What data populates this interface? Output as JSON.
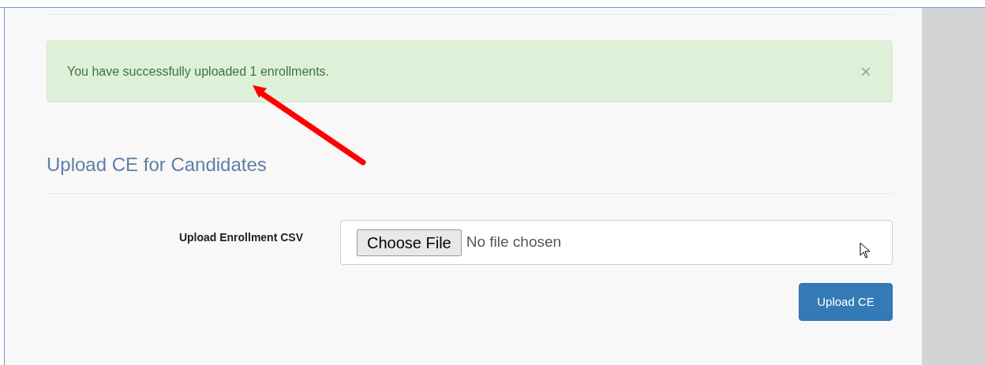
{
  "alert": {
    "message": "You have successfully uploaded 1 enrollments.",
    "dismissible": true,
    "close": "×"
  },
  "heading": "Upload CE for Candidates",
  "form": {
    "label": "Upload Enrollment CSV",
    "file_button": "Choose File",
    "file_status": "No file chosen",
    "submit": "Upload CE"
  }
}
